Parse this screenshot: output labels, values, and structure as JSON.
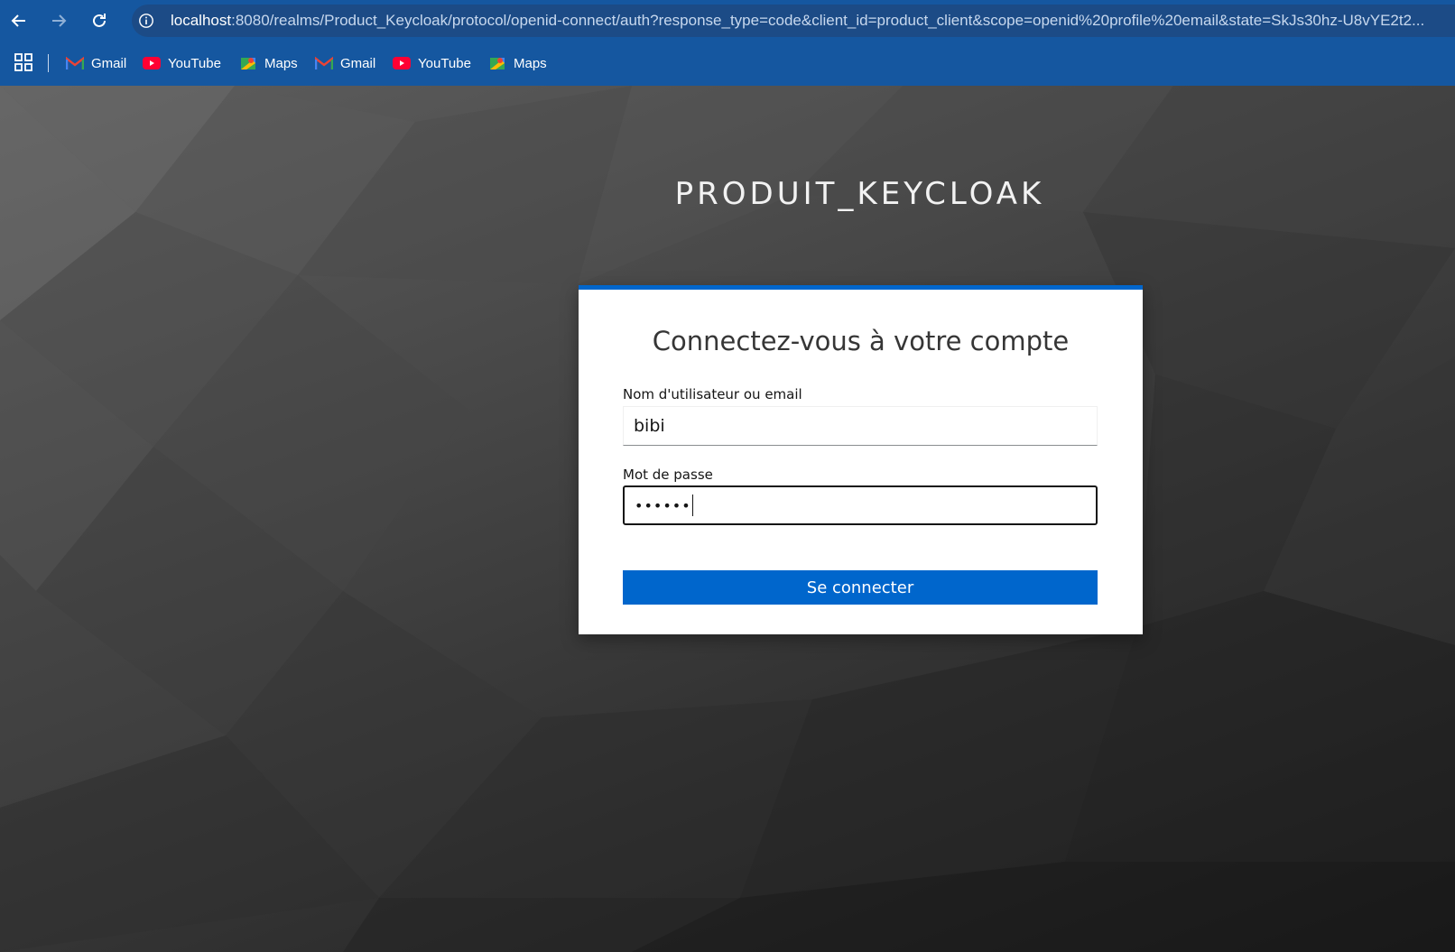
{
  "browser": {
    "url_host": "localhost",
    "url_rest": ":8080/realms/Product_Keycloak/protocol/openid-connect/auth?response_type=code&client_id=product_client&scope=openid%20profile%20email&state=SkJs30hz-U8vYE2t2...",
    "nav_icons": [
      "back-arrow-icon",
      "forward-arrow-icon",
      "reload-icon",
      "info-icon"
    ],
    "bookmarks": [
      {
        "label": "Gmail",
        "icon": "gmail-icon"
      },
      {
        "label": "YouTube",
        "icon": "youtube-icon"
      },
      {
        "label": "Maps",
        "icon": "maps-icon"
      },
      {
        "label": "Gmail",
        "icon": "gmail-icon"
      },
      {
        "label": "YouTube",
        "icon": "youtube-icon"
      },
      {
        "label": "Maps",
        "icon": "maps-icon"
      }
    ]
  },
  "login": {
    "realm_title": "PRODUIT_KEYCLOAK",
    "heading": "Connectez-vous à votre compte",
    "username_label": "Nom d'utilisateur ou email",
    "username_value": "bibi",
    "password_label": "Mot de passe",
    "password_mask": "••••••",
    "submit_label": "Se connecter"
  },
  "colors": {
    "chrome": "#1557a0",
    "accent": "#0066cc",
    "card": "#ffffff"
  }
}
